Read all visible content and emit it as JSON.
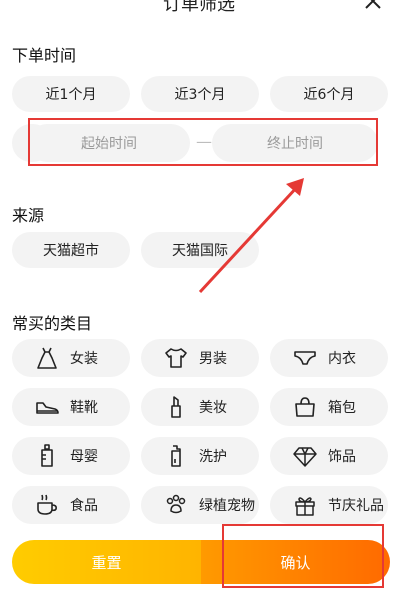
{
  "header": {
    "title": "订单筛选"
  },
  "sections": {
    "order_time": {
      "title": "下单时间",
      "ranges": [
        "近1个月",
        "近3个月",
        "近6个月"
      ],
      "start_placeholder": "起始时间",
      "end_placeholder": "终止时间",
      "separator": "—"
    },
    "source": {
      "title": "来源",
      "items": [
        "天猫超市",
        "天猫国际"
      ]
    },
    "categories": {
      "title": "常买的类目",
      "items": [
        {
          "label": "女装",
          "icon": "dress-icon"
        },
        {
          "label": "男装",
          "icon": "tshirt-icon"
        },
        {
          "label": "内衣",
          "icon": "underwear-icon"
        },
        {
          "label": "鞋靴",
          "icon": "shoe-icon"
        },
        {
          "label": "美妆",
          "icon": "lipstick-icon"
        },
        {
          "label": "箱包",
          "icon": "bag-icon"
        },
        {
          "label": "母婴",
          "icon": "baby-bottle-icon"
        },
        {
          "label": "洗护",
          "icon": "bottle-icon"
        },
        {
          "label": "饰品",
          "icon": "diamond-icon"
        },
        {
          "label": "食品",
          "icon": "cup-icon"
        },
        {
          "label": "绿植宠物",
          "icon": "paw-icon"
        },
        {
          "label": "节庆礼品",
          "icon": "gift-icon"
        }
      ]
    }
  },
  "footer": {
    "reset_label": "重置",
    "confirm_label": "确认"
  },
  "colors": {
    "accent_yellow": "#ffc000",
    "accent_orange": "#ff7a00",
    "annotation_red": "#e53935",
    "chip_bg": "#f3f3f3"
  }
}
